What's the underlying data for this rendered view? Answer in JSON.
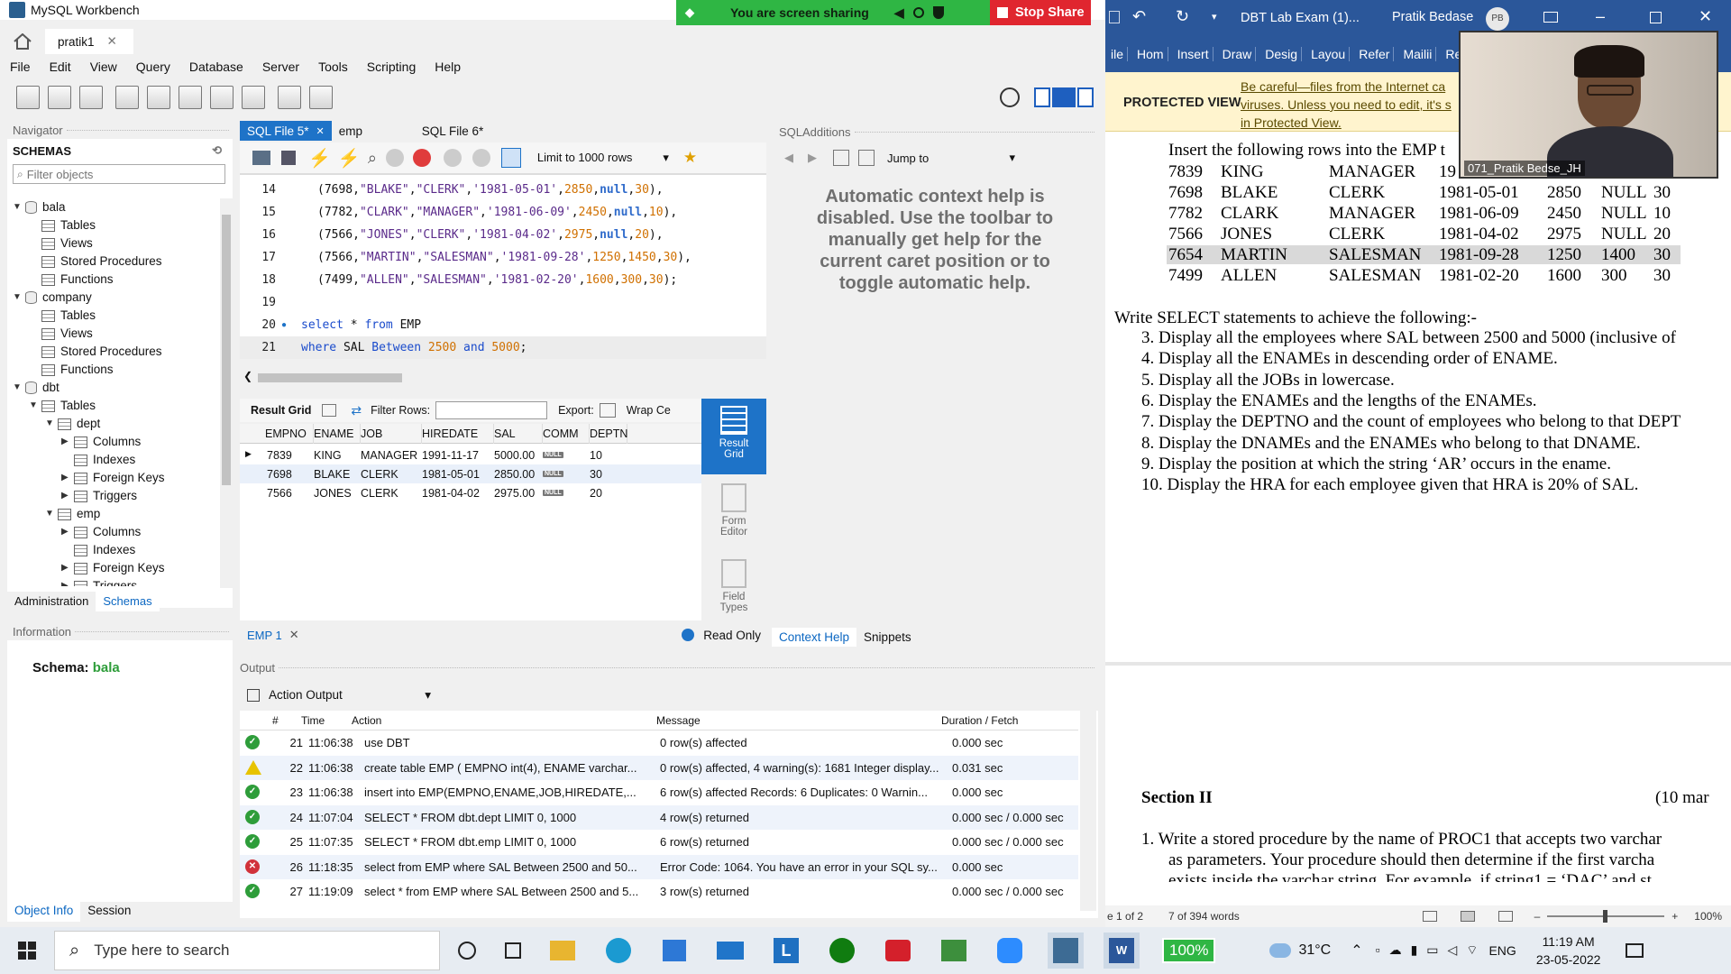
{
  "workbench": {
    "window_title": "MySQL Workbench",
    "conn_tab": "pratik1",
    "menu": [
      "File",
      "Edit",
      "View",
      "Query",
      "Database",
      "Server",
      "Tools",
      "Scripting",
      "Help"
    ],
    "navigator_title": "Navigator",
    "schemas_title": "SCHEMAS",
    "filter_placeholder": "Filter objects",
    "tree": [
      {
        "label": "bala",
        "level": 0,
        "type": "db"
      },
      {
        "label": "Tables",
        "level": 1,
        "type": "folder"
      },
      {
        "label": "Views",
        "level": 1,
        "type": "folder"
      },
      {
        "label": "Stored Procedures",
        "level": 1,
        "type": "folder"
      },
      {
        "label": "Functions",
        "level": 1,
        "type": "folder"
      },
      {
        "label": "company",
        "level": 0,
        "type": "db"
      },
      {
        "label": "Tables",
        "level": 1,
        "type": "folder"
      },
      {
        "label": "Views",
        "level": 1,
        "type": "folder"
      },
      {
        "label": "Stored Procedures",
        "level": 1,
        "type": "folder"
      },
      {
        "label": "Functions",
        "level": 1,
        "type": "folder"
      },
      {
        "label": "dbt",
        "level": 0,
        "type": "db"
      },
      {
        "label": "Tables",
        "level": 1,
        "type": "folder"
      },
      {
        "label": "dept",
        "level": 2,
        "type": "table"
      },
      {
        "label": "Columns",
        "level": 3,
        "type": "folder"
      },
      {
        "label": "Indexes",
        "level": 3,
        "type": "folder"
      },
      {
        "label": "Foreign Keys",
        "level": 3,
        "type": "folder"
      },
      {
        "label": "Triggers",
        "level": 3,
        "type": "folder"
      },
      {
        "label": "emp",
        "level": 2,
        "type": "table"
      },
      {
        "label": "Columns",
        "level": 3,
        "type": "folder"
      },
      {
        "label": "Indexes",
        "level": 3,
        "type": "folder"
      },
      {
        "label": "Foreign Keys",
        "level": 3,
        "type": "folder"
      },
      {
        "label": "Triggers",
        "level": 3,
        "type": "folder"
      }
    ],
    "nav_tabs": [
      "Administration",
      "Schemas"
    ],
    "info_title": "Information",
    "schema_label": "Schema:",
    "schema_value": "bala",
    "bottom_tabs": [
      "Object Info",
      "Session"
    ],
    "sql_tabs": [
      "SQL File 5*",
      "emp",
      "SQL File 6*"
    ],
    "limit_label": "Limit to 1000 rows",
    "editor_lines": [
      {
        "n": "14",
        "parts": [
          [
            "p",
            "(7698,"
          ],
          [
            "s",
            "\"BLAKE\""
          ],
          [
            "p",
            ","
          ],
          [
            "s",
            "\"CLERK\""
          ],
          [
            "p",
            ","
          ],
          [
            "s",
            "'1981-05-01'"
          ],
          [
            "p",
            ","
          ],
          [
            "n",
            "2850"
          ],
          [
            "p",
            ","
          ],
          [
            "u",
            "null"
          ],
          [
            "p",
            ","
          ],
          [
            "n",
            "30"
          ],
          [
            "p",
            "),"
          ]
        ]
      },
      {
        "n": "15",
        "parts": [
          [
            "p",
            "(7782,"
          ],
          [
            "s",
            "\"CLARK\""
          ],
          [
            "p",
            ","
          ],
          [
            "s",
            "\"MANAGER\""
          ],
          [
            "p",
            ","
          ],
          [
            "s",
            "'1981-06-09'"
          ],
          [
            "p",
            ","
          ],
          [
            "n",
            "2450"
          ],
          [
            "p",
            ","
          ],
          [
            "u",
            "null"
          ],
          [
            "p",
            ","
          ],
          [
            "n",
            "10"
          ],
          [
            "p",
            "),"
          ]
        ]
      },
      {
        "n": "16",
        "parts": [
          [
            "p",
            "(7566,"
          ],
          [
            "s",
            "\"JONES\""
          ],
          [
            "p",
            ","
          ],
          [
            "s",
            "\"CLERK\""
          ],
          [
            "p",
            ","
          ],
          [
            "s",
            "'1981-04-02'"
          ],
          [
            "p",
            ","
          ],
          [
            "n",
            "2975"
          ],
          [
            "p",
            ","
          ],
          [
            "u",
            "null"
          ],
          [
            "p",
            ","
          ],
          [
            "n",
            "20"
          ],
          [
            "p",
            "),"
          ]
        ]
      },
      {
        "n": "17",
        "parts": [
          [
            "p",
            "(7566,"
          ],
          [
            "s",
            "\"MARTIN\""
          ],
          [
            "p",
            ","
          ],
          [
            "s",
            "\"SALESMAN\""
          ],
          [
            "p",
            ","
          ],
          [
            "s",
            "'1981-09-28'"
          ],
          [
            "p",
            ","
          ],
          [
            "n",
            "1250"
          ],
          [
            "p",
            ","
          ],
          [
            "n",
            "1450"
          ],
          [
            "p",
            ","
          ],
          [
            "n",
            "30"
          ],
          [
            "p",
            "),"
          ]
        ]
      },
      {
        "n": "18",
        "parts": [
          [
            "p",
            "(7499,"
          ],
          [
            "s",
            "\"ALLEN\""
          ],
          [
            "p",
            ","
          ],
          [
            "s",
            "\"SALESMAN\""
          ],
          [
            "p",
            ","
          ],
          [
            "s",
            "'1981-02-20'"
          ],
          [
            "p",
            ","
          ],
          [
            "n",
            "1600"
          ],
          [
            "p",
            ","
          ],
          [
            "n",
            "300"
          ],
          [
            "p",
            ","
          ],
          [
            "n",
            "30"
          ],
          [
            "p",
            ");"
          ]
        ]
      },
      {
        "n": "19",
        "parts": []
      },
      {
        "n": "20",
        "parts": [
          [
            "k",
            "select"
          ],
          [
            "p",
            " * "
          ],
          [
            "k",
            "from"
          ],
          [
            "p",
            " EMP"
          ]
        ]
      },
      {
        "n": "21",
        "parts": [
          [
            "k",
            "where"
          ],
          [
            "p",
            " SAL "
          ],
          [
            "k",
            "Between"
          ],
          [
            "p",
            " "
          ],
          [
            "n",
            "2500"
          ],
          [
            "p",
            " "
          ],
          [
            "k",
            "and"
          ],
          [
            "p",
            " "
          ],
          [
            "n",
            "5000"
          ],
          [
            "p",
            ";"
          ]
        ]
      }
    ],
    "sqladd_title": "SQLAdditions",
    "jump_to": "Jump to",
    "context_help": "Automatic context help is disabled. Use the toolbar to manually get help for the current caret position or to toggle automatic help.",
    "result_tabs": {
      "grid": "Result Grid",
      "filter": "Filter Rows:",
      "export": "Export:",
      "wrap": "Wrap Ce"
    },
    "grid_columns": [
      "EMPNO",
      "ENAME",
      "JOB",
      "HIREDATE",
      "SAL",
      "COMM",
      "DEPTN"
    ],
    "grid_rows": [
      [
        "7839",
        "KING",
        "MANAGER",
        "1991-11-17",
        "5000.00",
        "NULL",
        "10"
      ],
      [
        "7698",
        "BLAKE",
        "CLERK",
        "1981-05-01",
        "2850.00",
        "NULL",
        "30"
      ],
      [
        "7566",
        "JONES",
        "CLERK",
        "1981-04-02",
        "2975.00",
        "NULL",
        "20"
      ]
    ],
    "side_buttons": [
      "Result Grid",
      "Form Editor",
      "Field Types"
    ],
    "emp_tab": "EMP 1",
    "read_only": "Read Only",
    "help_tabs": [
      "Context Help",
      "Snippets"
    ],
    "output_title": "Output",
    "output_select": "Action Output",
    "output_headers": [
      "#",
      "Time",
      "Action",
      "Message",
      "Duration / Fetch"
    ],
    "output_rows": [
      {
        "status": "ok",
        "n": "21",
        "time": "11:06:38",
        "action": "use DBT",
        "message": "0 row(s) affected",
        "duration": "0.000 sec"
      },
      {
        "status": "warn",
        "n": "22",
        "time": "11:06:38",
        "action": "create table EMP (  EMPNO int(4),  ENAME varchar...",
        "message": "0 row(s) affected, 4 warning(s): 1681 Integer display...",
        "duration": "0.031 sec"
      },
      {
        "status": "ok",
        "n": "23",
        "time": "11:06:38",
        "action": "insert into EMP(EMPNO,ENAME,JOB,HIREDATE,...",
        "message": "6 row(s) affected Records: 6  Duplicates: 0  Warnin...",
        "duration": "0.000 sec"
      },
      {
        "status": "ok",
        "n": "24",
        "time": "11:07:04",
        "action": "SELECT * FROM dbt.dept LIMIT 0, 1000",
        "message": "4 row(s) returned",
        "duration": "0.000 sec / 0.000 sec"
      },
      {
        "status": "ok",
        "n": "25",
        "time": "11:07:35",
        "action": "SELECT * FROM dbt.emp LIMIT 0, 1000",
        "message": "6 row(s) returned",
        "duration": "0.000 sec / 0.000 sec"
      },
      {
        "status": "err",
        "n": "26",
        "time": "11:18:35",
        "action": "select  from EMP where SAL Between 2500 and 50...",
        "message": "Error Code: 1064. You have an error in your SQL sy...",
        "duration": "0.000 sec"
      },
      {
        "status": "ok",
        "n": "27",
        "time": "11:19:09",
        "action": "select * from EMP where SAL Between 2500 and 5...",
        "message": "3 row(s) returned",
        "duration": "0.000 sec / 0.000 sec"
      }
    ]
  },
  "share_bar": {
    "text": "You are screen sharing",
    "stop": "Stop Share"
  },
  "word": {
    "title": "DBT Lab Exam (1)...",
    "user": "Pratik Bedase",
    "initials": "PB",
    "ribbon": [
      "ile",
      "Hom",
      "Insert",
      "Draw",
      "Desig",
      "Layou",
      "Refer",
      "Mailii",
      "Revie"
    ],
    "protected_label": "PROTECTED VIEW",
    "protected_msg": [
      "Be careful—files from the Internet ca",
      "viruses. Unless you need to edit, it's s",
      "in Protected View."
    ],
    "intro": "Insert the following rows into the EMP t",
    "emp_rows": [
      [
        "7839",
        "KING",
        "MANAGER",
        "19",
        "",
        "",
        " "
      ],
      [
        "7698",
        "BLAKE",
        "CLERK",
        "1981-05-01",
        "2850",
        "NULL",
        "30"
      ],
      [
        "7782",
        "CLARK",
        "MANAGER",
        "1981-06-09",
        "2450",
        "NULL",
        "10"
      ],
      [
        "7566",
        "JONES",
        "CLERK",
        "1981-04-02",
        "2975",
        "NULL",
        "20"
      ],
      [
        "7654",
        "MARTIN",
        "SALESMAN",
        "1981-09-28",
        "1250",
        "1400",
        "30"
      ],
      [
        "7499",
        "ALLEN",
        "SALESMAN",
        "1981-02-20",
        "1600",
        "300",
        "30"
      ]
    ],
    "select_heading": "Write SELECT statements to achieve the following:-",
    "questions": [
      "3.  Display all the employees where SAL between 2500 and 5000 (inclusive of",
      "4.  Display all the ENAMEs in descending order of ENAME.",
      "5.  Display all the JOBs in lowercase.",
      "6.  Display the ENAMEs and the lengths of the ENAMEs.",
      "7.  Display the DEPTNO and the count of employees who belong to that DEPT",
      "8.  Display the DNAMEs and the ENAMEs who belong to that DNAME.",
      "9.  Display the position at which the string ‘AR’ occurs in the ename.",
      "10. Display the HRA for each employee given that HRA is 20% of SAL."
    ],
    "section": "Section II",
    "section_marks": "(10 mar",
    "sec2_lines": [
      "1.  Write a stored procedure by the name of PROC1 that accepts two varchar",
      "as parameters. Your procedure should then determine if the first varcha",
      "exists inside the varchar string. For example, if string1 = ‘DAC’ and st"
    ],
    "status_page": "e 1 of 2",
    "status_words": "7 of 394 words",
    "zoom": "100%"
  },
  "video": {
    "name": "071_Pratik Bedse_JH"
  },
  "taskbar": {
    "search_placeholder": "Type here to search",
    "battery": "100%",
    "temp": "31°C",
    "lang": "ENG",
    "time": "11:19 AM",
    "date": "23-05-2022"
  },
  "colors": {
    "accent": "#0b67c2",
    "word_blue": "#2b579a",
    "share_green": "#2fb644",
    "stop_red": "#e0262f"
  }
}
